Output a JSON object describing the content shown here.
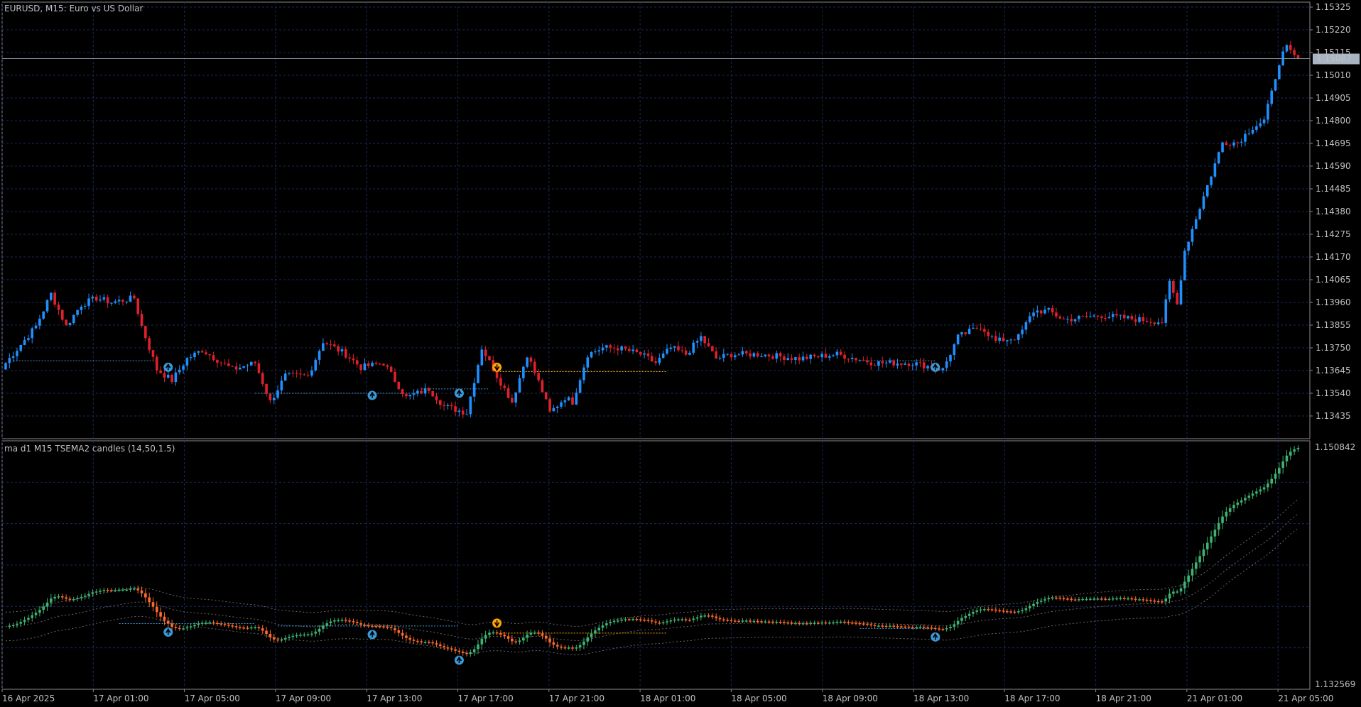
{
  "main_panel": {
    "title": "EURUSD, M15:  Euro vs US Dollar",
    "current_price": "1.15087",
    "price_ticks": [
      "1.15325",
      "1.15220",
      "1.15115",
      "1.15010",
      "1.14905",
      "1.14800",
      "1.14695",
      "1.14590",
      "1.14485",
      "1.14380",
      "1.14275",
      "1.14170",
      "1.14065",
      "1.13960",
      "1.13855",
      "1.13750",
      "1.13645",
      "1.13540",
      "1.13435"
    ]
  },
  "indicator_panel": {
    "title": "ma d1 M15 TSEMA2 candles (14,50,1.5)",
    "top_value": "1.150842",
    "bottom_value": "1.132569"
  },
  "time_axis": {
    "labels": [
      "16 Apr 2025",
      "17 Apr 01:00",
      "17 Apr 05:00",
      "17 Apr 09:00",
      "17 Apr 13:00",
      "17 Apr 17:00",
      "17 Apr 21:00",
      "18 Apr 01:00",
      "18 Apr 05:00",
      "18 Apr 09:00",
      "18 Apr 13:00",
      "18 Apr 17:00",
      "18 Apr 21:00",
      "21 Apr 01:00",
      "21 Apr 05:00"
    ]
  },
  "colors": {
    "background": "#000000",
    "grid": "#1a2a5a",
    "bull_candle": "#1e90ff",
    "bear_candle": "#e0202a",
    "ind_up": "#3cb371",
    "ind_down": "#ff6a2a",
    "signal_up": "#3a9ad9",
    "signal_down": "#ffa500",
    "text": "#c0c0c0"
  },
  "chart_data": [
    {
      "type": "candlestick",
      "title": "EURUSD, M15:  Euro vs US Dollar",
      "ylim": [
        1.1333,
        1.1536
      ],
      "close_path": [
        [
          0,
          1.1368
        ],
        [
          8,
          1.1385
        ],
        [
          12,
          1.14
        ],
        [
          16,
          1.1385
        ],
        [
          20,
          1.1395
        ],
        [
          24,
          1.1398
        ],
        [
          28,
          1.1396
        ],
        [
          34,
          1.1398
        ],
        [
          36,
          1.1385
        ],
        [
          40,
          1.1365
        ],
        [
          44,
          1.136
        ],
        [
          48,
          1.137
        ],
        [
          52,
          1.1374
        ],
        [
          60,
          1.1365
        ],
        [
          66,
          1.1368
        ],
        [
          70,
          1.135
        ],
        [
          74,
          1.1362
        ],
        [
          80,
          1.1362
        ],
        [
          84,
          1.1378
        ],
        [
          90,
          1.1372
        ],
        [
          94,
          1.1366
        ],
        [
          100,
          1.1368
        ],
        [
          106,
          1.1352
        ],
        [
          112,
          1.1356
        ],
        [
          116,
          1.1348
        ],
        [
          122,
          1.1345
        ],
        [
          126,
          1.1375
        ],
        [
          130,
          1.1362
        ],
        [
          134,
          1.135
        ],
        [
          138,
          1.1372
        ],
        [
          142,
          1.1355
        ],
        [
          144,
          1.1345
        ],
        [
          148,
          1.1352
        ],
        [
          150,
          1.135
        ],
        [
          154,
          1.1372
        ],
        [
          158,
          1.1375
        ],
        [
          162,
          1.1375
        ],
        [
          168,
          1.1372
        ],
        [
          172,
          1.1368
        ],
        [
          176,
          1.1375
        ],
        [
          180,
          1.1372
        ],
        [
          184,
          1.138
        ],
        [
          188,
          1.137
        ],
        [
          192,
          1.1372
        ],
        [
          200,
          1.1372
        ],
        [
          210,
          1.137
        ],
        [
          220,
          1.1372
        ],
        [
          230,
          1.1368
        ],
        [
          240,
          1.1368
        ],
        [
          248,
          1.1365
        ],
        [
          252,
          1.138
        ],
        [
          258,
          1.1385
        ],
        [
          262,
          1.1378
        ],
        [
          268,
          1.138
        ],
        [
          272,
          1.1392
        ],
        [
          276,
          1.1392
        ],
        [
          280,
          1.1388
        ],
        [
          290,
          1.139
        ],
        [
          300,
          1.1388
        ],
        [
          306,
          1.1387
        ],
        [
          308,
          1.1405
        ],
        [
          310,
          1.1395
        ],
        [
          312,
          1.142
        ],
        [
          318,
          1.145
        ],
        [
          322,
          1.147
        ],
        [
          326,
          1.147
        ],
        [
          330,
          1.1477
        ],
        [
          333,
          1.148
        ],
        [
          338,
          1.1512
        ],
        [
          339,
          1.1515
        ],
        [
          342,
          1.1508
        ]
      ],
      "last_price": 1.15087
    },
    {
      "type": "line",
      "title": "ma d1 M15 TSEMA2 candles (14,50,1.5)",
      "ylim": [
        1.132569,
        1.150842
      ]
    }
  ]
}
